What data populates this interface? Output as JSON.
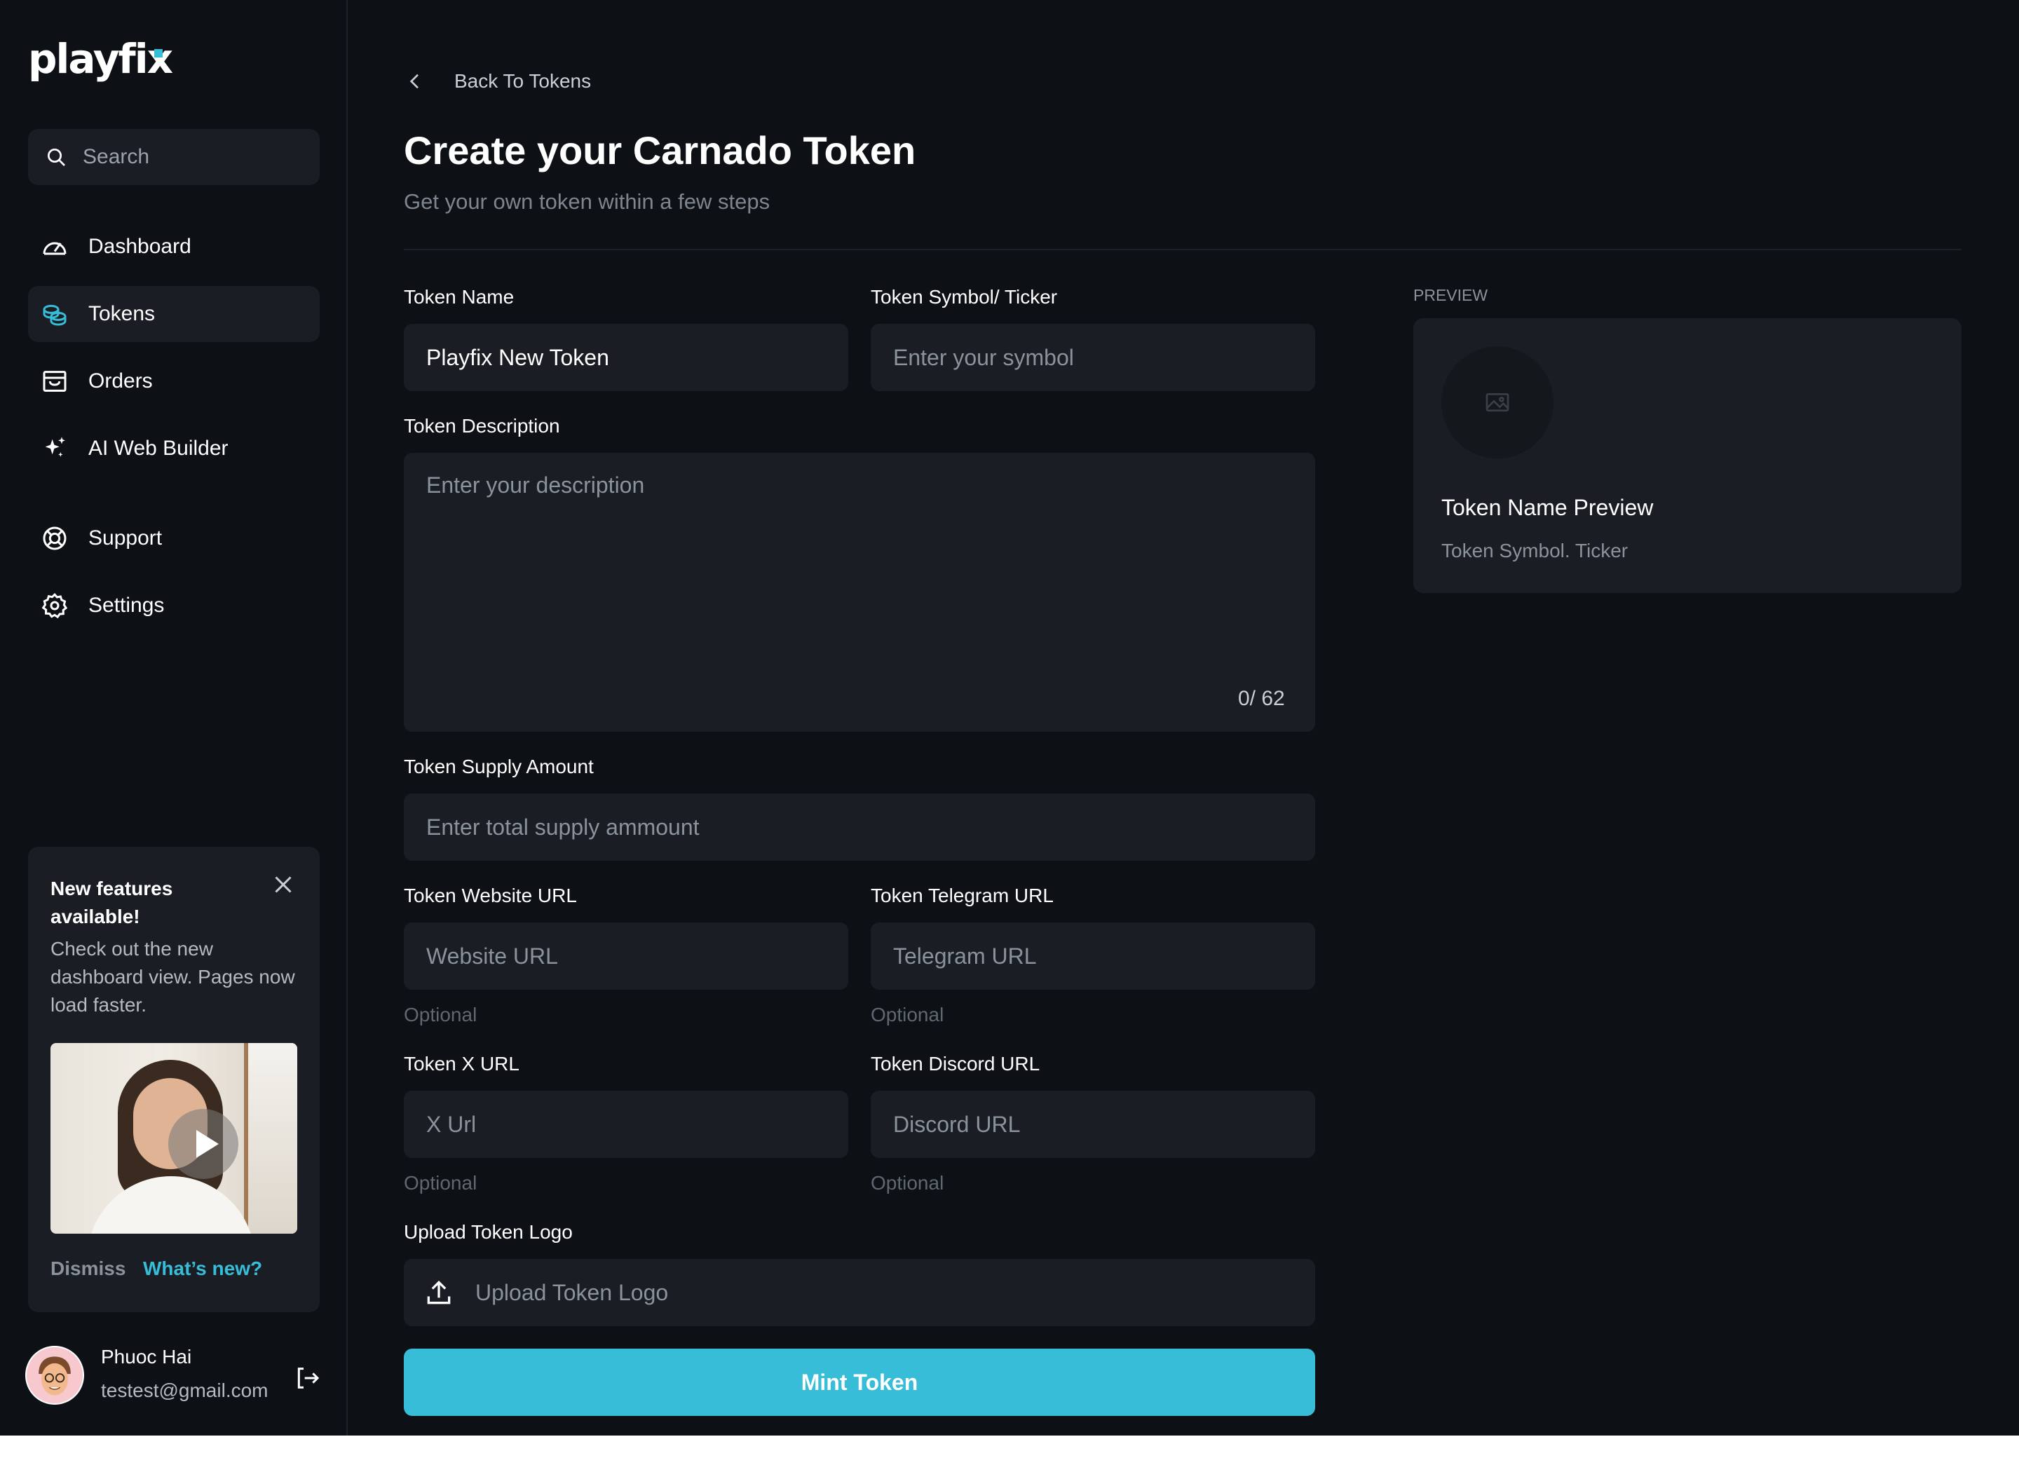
{
  "brand": {
    "logo_text": "playfix",
    "accent_color": "#38bdd8"
  },
  "sidebar": {
    "search": {
      "placeholder": "Search"
    },
    "nav": [
      {
        "label": "Dashboard",
        "icon": "dashboard-gauge-icon"
      },
      {
        "label": "Tokens",
        "icon": "coins-icon",
        "active": true
      },
      {
        "label": "Orders",
        "icon": "archive-box-icon"
      },
      {
        "label": "AI Web Builder",
        "icon": "sparkles-icon"
      },
      {
        "label": "Support",
        "icon": "lifebuoy-icon"
      },
      {
        "label": "Settings",
        "icon": "gear-icon"
      }
    ],
    "promo": {
      "title": "New features available!",
      "text": "Check out the new dashboard view. Pages now load faster.",
      "dismiss": "Dismiss",
      "whats_new": "What’s new?"
    },
    "user": {
      "name": "Phuoc Hai",
      "email": "testest@gmail.com"
    }
  },
  "main": {
    "back_label": "Back To Tokens",
    "title": "Create your Carnado Token",
    "subtitle": "Get your own token within a few steps",
    "form": {
      "name": {
        "label": "Token Name",
        "value": "Playfix New Token"
      },
      "symbol": {
        "label": "Token Symbol/ Ticker",
        "placeholder": "Enter your symbol"
      },
      "description": {
        "label": "Token Description",
        "placeholder": "Enter your description",
        "counter": "0/ 62"
      },
      "supply": {
        "label": "Token Supply Amount",
        "placeholder": "Enter total supply ammount"
      },
      "website": {
        "label": "Token Website URL",
        "placeholder": "Website URL",
        "hint": "Optional"
      },
      "telegram": {
        "label": "Token Telegram URL",
        "placeholder": "Telegram URL",
        "hint": "Optional"
      },
      "x": {
        "label": "Token X URL",
        "placeholder": "X Url",
        "hint": "Optional"
      },
      "discord": {
        "label": "Token Discord URL",
        "placeholder": "Discord URL",
        "hint": "Optional"
      },
      "upload": {
        "label": "Upload Token Logo",
        "button": "Upload Token Logo"
      },
      "submit": "Mint Token"
    },
    "preview": {
      "label": "PREVIEW",
      "name": "Token Name Preview",
      "ticker": "Token Symbol. Ticker"
    }
  }
}
